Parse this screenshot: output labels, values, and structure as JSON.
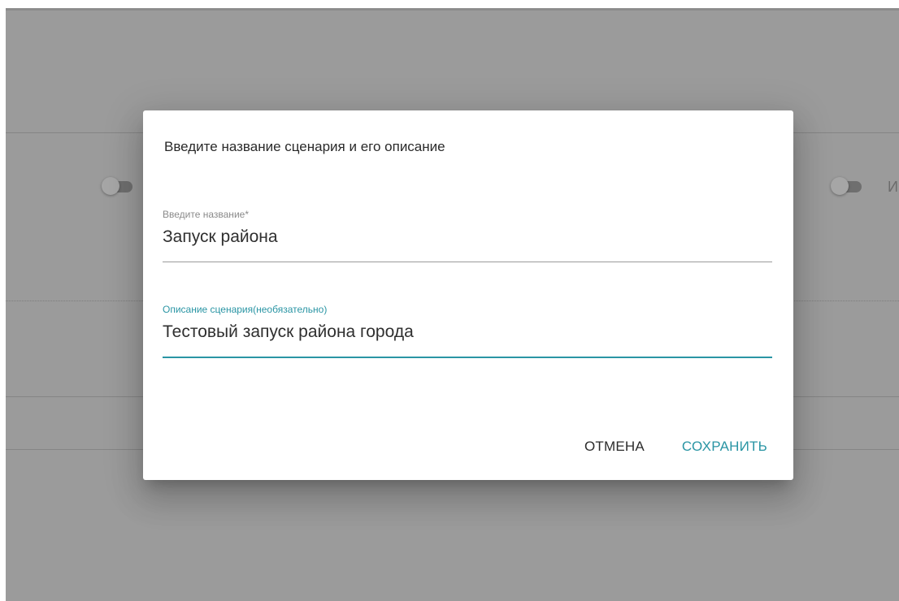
{
  "dialog": {
    "title": "Введите название сценария и его описание",
    "name_field": {
      "label": "Введите название*",
      "value": "Запуск района"
    },
    "description_field": {
      "label": "Описание сценария(необязательно)",
      "value": "Тестовый запуск района города"
    },
    "actions": {
      "cancel_label": "ОТМЕНА",
      "save_label": "СОХРАНИТЬ"
    }
  },
  "background": {
    "partial_text_right": "И"
  },
  "colors": {
    "accent": "#2a95a4",
    "overlay": "#9b9b9b",
    "dialog_bg": "#ffffff"
  }
}
